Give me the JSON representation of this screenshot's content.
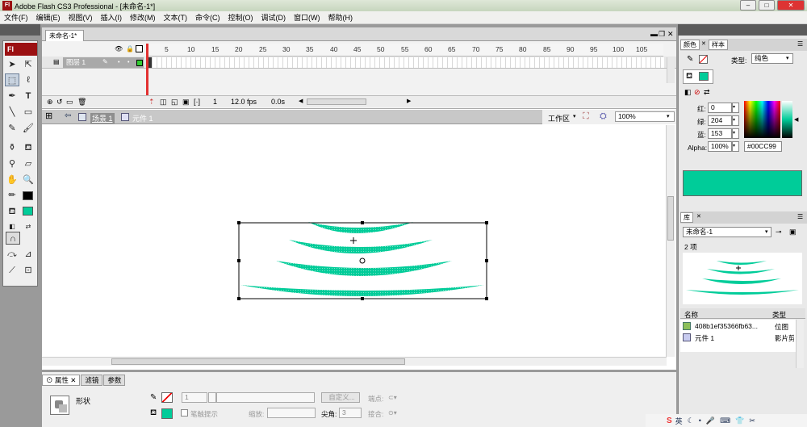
{
  "window": {
    "logo": "Fl",
    "title": "Adobe Flash CS3 Professional - [未命名-1*]",
    "btn_min": "–",
    "btn_max": "□",
    "btn_close": "✕"
  },
  "menu": [
    "文件(F)",
    "编辑(E)",
    "视图(V)",
    "插入(I)",
    "修改(M)",
    "文本(T)",
    "命令(C)",
    "控制(O)",
    "调试(D)",
    "窗口(W)",
    "帮助(H)"
  ],
  "tools": {
    "logo": "Fl"
  },
  "document": {
    "tab": "未命名-1*"
  },
  "timeline": {
    "ruler": [
      "5",
      "10",
      "15",
      "20",
      "25",
      "30",
      "35",
      "40",
      "45",
      "50",
      "55",
      "60",
      "65",
      "70",
      "75",
      "80",
      "85",
      "90",
      "95",
      "100",
      "105"
    ],
    "layer_name": "图层 1",
    "current_frame": "1",
    "fps": "12.0 fps",
    "time": "0.0s"
  },
  "editbar": {
    "scene": "场景 1",
    "symbol": "元件 1",
    "workspace": "工作区",
    "zoom": "100%"
  },
  "properties": {
    "tabs": [
      "属性",
      "滤镜",
      "参数"
    ],
    "shape_label": "形状",
    "stroke_height": "1",
    "custom_button": "自定义...",
    "endpoint_label": "端点:",
    "hinting_label": "笔触提示",
    "scale_label": "缩放:",
    "miter_label": "尖角:",
    "miter_value": "3",
    "join_label": "接合:"
  },
  "color_panel": {
    "tabs": [
      "颜色",
      "样本"
    ],
    "type_label": "类型:",
    "type_value": "纯色",
    "red_label": "红:",
    "red_value": "0",
    "green_label": "绿:",
    "green_value": "204",
    "blue_label": "蓝:",
    "blue_value": "153",
    "alpha_label": "Alpha:",
    "alpha_value": "100%",
    "hex_value": "#00CC99",
    "fill_color": "#00CC99"
  },
  "library": {
    "tab": "库",
    "doc": "未命名-1",
    "count": "2 项",
    "col_name": "名称",
    "col_type": "类型",
    "items": [
      {
        "name": "408b1ef35366fb63...",
        "type": "位图"
      },
      {
        "name": "元件 1",
        "type": "影片剪"
      }
    ]
  },
  "taskbar": {
    "ime": "英"
  }
}
